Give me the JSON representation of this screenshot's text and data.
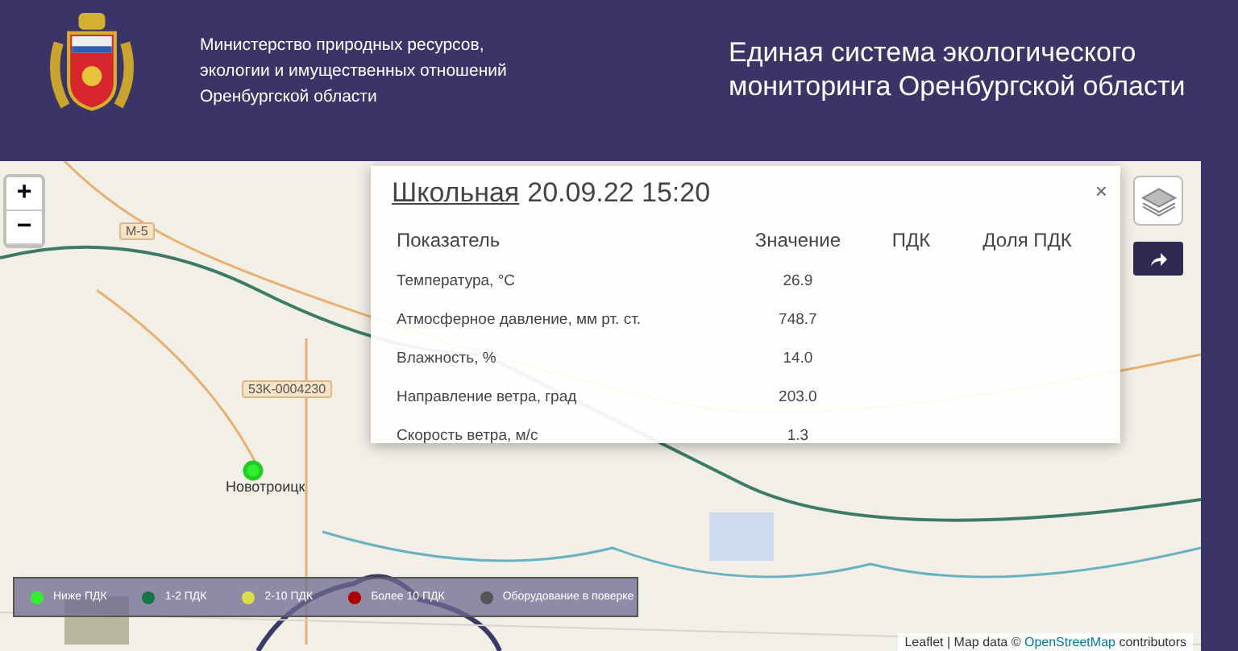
{
  "header": {
    "ministry_lines": [
      "Министерство природных ресурсов,",
      "экологии и имущественных отношений",
      "Оренбургской области"
    ],
    "title_lines": [
      "Единая система экологического",
      "мониторинга Оренбургской области"
    ]
  },
  "map": {
    "zoom_in": "+",
    "zoom_out": "−",
    "labels": [
      {
        "kind": "road",
        "text": "M-5"
      },
      {
        "kind": "road",
        "text": "53K-0004230"
      },
      {
        "kind": "city",
        "text": "Новотроицк"
      }
    ],
    "attribution": {
      "prefix": "Leaflet | Map data © ",
      "link": "OpenStreetMap",
      "suffix": " contributors"
    }
  },
  "popup": {
    "station": "Школьная",
    "datetime": "20.09.22 15:20",
    "close": "×",
    "columns": [
      "Показатель",
      "Значение",
      "ПДК",
      "Доля ПДК"
    ],
    "rows": [
      {
        "name": "Температура, °C",
        "value": "26.9"
      },
      {
        "name": "Атмосферное давление, мм рт. ст.",
        "value": "748.7"
      },
      {
        "name": "Влажность, %",
        "value": "14.0"
      },
      {
        "name": "Направление ветра, град",
        "value": "203.0"
      },
      {
        "name": "Скорость ветра, м/с",
        "value": "1.3"
      }
    ]
  },
  "legend": [
    {
      "label": "Ниже ПДК",
      "color": "#33ee33"
    },
    {
      "label": "1-2 ПДК",
      "color": "#117744"
    },
    {
      "label": "2-10 ПДК",
      "color": "#dddd44"
    },
    {
      "label": "Более 10 ПДК",
      "color": "#aa0000"
    },
    {
      "label": "Оборудование в поверке",
      "color": "#555555"
    }
  ]
}
